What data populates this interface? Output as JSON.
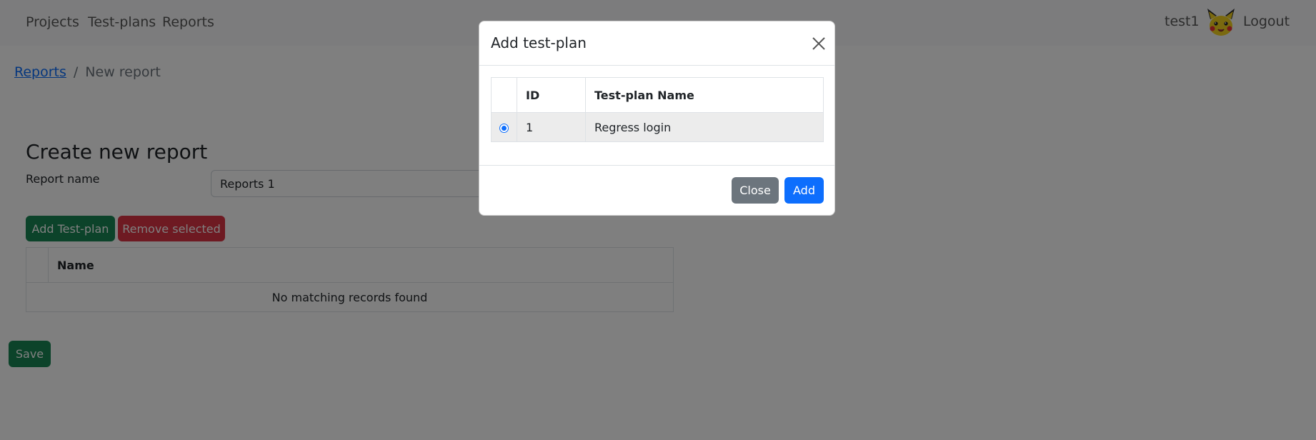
{
  "navbar": {
    "links": [
      "Projects",
      "Test-plans",
      "Reports"
    ],
    "user": "test1",
    "logout": "Logout",
    "avatar_icon": "pikachu-avatar"
  },
  "breadcrumb": {
    "parent": "Reports",
    "separator": "/",
    "current": "New report"
  },
  "form": {
    "title": "Create new report",
    "report_name_label": "Report name",
    "report_name_value": "Reports 1",
    "add_testplan_label": "Add Test-plan",
    "remove_selected_label": "Remove selected",
    "save_label": "Save"
  },
  "main_table": {
    "columns": [
      "",
      "Name"
    ],
    "empty_message": "No matching records found"
  },
  "modal": {
    "title": "Add test-plan",
    "close_icon": "close-icon",
    "columns": [
      "",
      "ID",
      "Test-plan Name"
    ],
    "rows": [
      {
        "selected": true,
        "id": "1",
        "name": "Regress login"
      }
    ],
    "close_label": "Close",
    "add_label": "Add"
  },
  "colors": {
    "primary": "#0d6efd",
    "success": "#198754",
    "danger": "#dc3545",
    "secondary": "#6c757d"
  }
}
